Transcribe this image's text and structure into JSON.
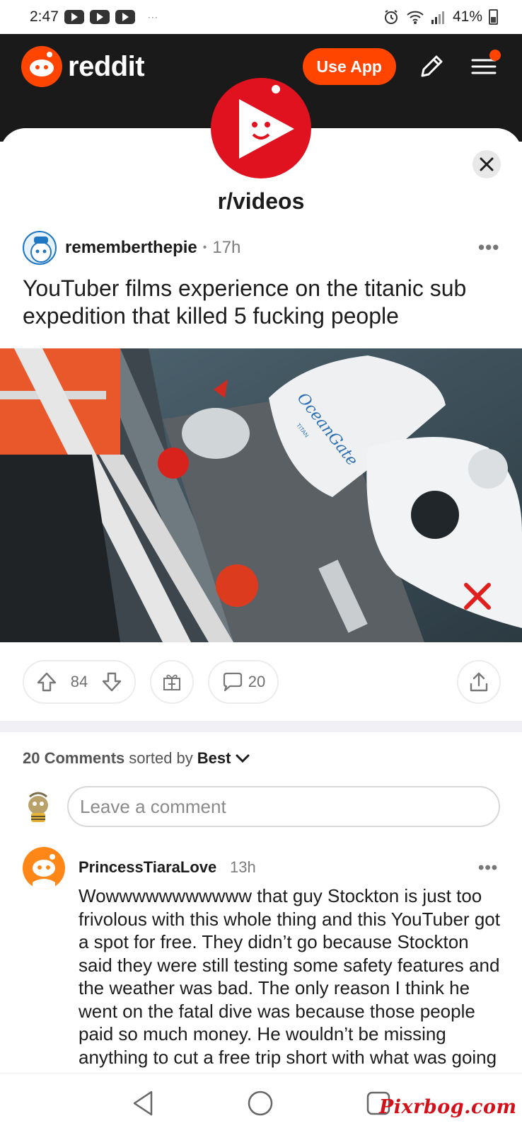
{
  "status_bar": {
    "time": "2:47",
    "dots": "···",
    "battery": "41%"
  },
  "header": {
    "brand": "reddit",
    "use_app_label": "Use App",
    "accent": "#ff4500"
  },
  "post": {
    "subreddit": "r/videos",
    "author": "rememberthepie",
    "separator": "•",
    "age": "17h",
    "title": "YouTuber films experience on the titanic sub expedition that killed 5 fucking people",
    "media_overlay_text": "OceanGate",
    "media_overlay_small": "TITAN",
    "score": "84",
    "comment_count": "20"
  },
  "comments_section": {
    "count_label": "20 Comments",
    "sorted_by_label": "sorted by",
    "sort_value": "Best",
    "input_placeholder": "Leave a comment"
  },
  "comments": [
    {
      "author": "PrincessTiaraLove",
      "age": "13h",
      "body": "Wowwwwwwwwwww that guy Stockton is just too frivolous with this whole thing and this YouTuber got a spot for free. They didn’t go because Stockton said they were still testing some safety features and the weather was bad. The only reason I think he went on the fatal dive was because those people paid so much money. He wouldn’t be missing anything to cut a free trip short with what was going on in the back..."
    }
  ],
  "watermark": "Pixrbog.com",
  "icons": [
    "youtube-icon",
    "alarm-icon",
    "wifi-icon",
    "signal-icon",
    "battery-icon",
    "reddit-logo-icon",
    "pencil-icon",
    "menu-icon",
    "close-icon",
    "more-icon",
    "upvote-icon",
    "downvote-icon",
    "award-icon",
    "comment-icon",
    "share-icon",
    "chevron-down-icon",
    "back-icon",
    "home-icon",
    "recents-icon"
  ]
}
